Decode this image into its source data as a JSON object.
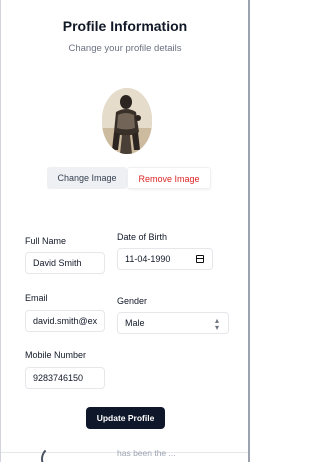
{
  "header": {
    "title": "Profile Information",
    "subtitle": "Change your profile details"
  },
  "avatar": {
    "icon": "profile-photo"
  },
  "photo_actions": {
    "change_label": "Change Image",
    "remove_label": "Remove Image"
  },
  "form": {
    "full_name": {
      "label": "Full Name",
      "value": "David Smith"
    },
    "dob": {
      "label": "Date of Birth",
      "value": "11-04-1990"
    },
    "email": {
      "label": "Email",
      "value": "david.smith@ex"
    },
    "gender": {
      "label": "Gender",
      "value": "Male"
    },
    "mobile": {
      "label": "Mobile Number",
      "value": "9283746150"
    }
  },
  "submit_label": "Update Profile",
  "background_text": "has been the ..."
}
